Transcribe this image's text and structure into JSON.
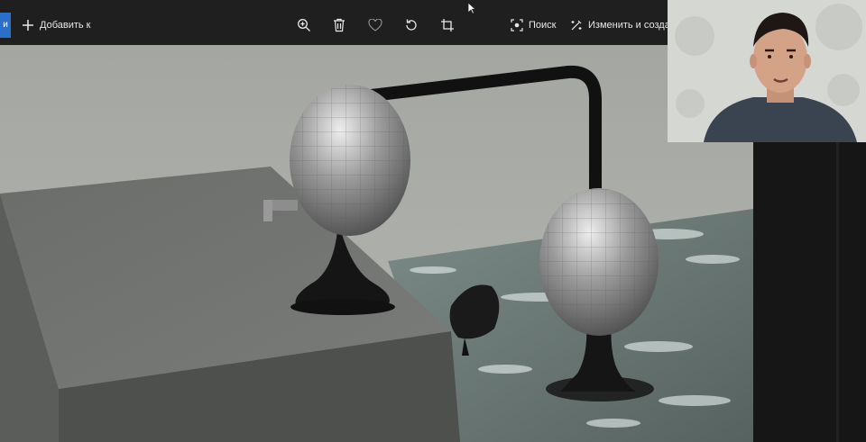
{
  "toolbar": {
    "edge_tab_label": "и",
    "add_label": "Добавить к",
    "search_label": "Поиск",
    "edit_create_label": "Изменить и создать",
    "icons": {
      "add": "plus-icon",
      "zoom": "zoom-in-icon",
      "delete": "trash-icon",
      "favorite": "heart-icon",
      "rotate": "rotate-icon",
      "crop": "crop-icon",
      "search": "visual-search-icon",
      "edit": "edit-create-icon"
    }
  },
  "colors": {
    "toolbar_bg": "#1f1f1f",
    "accent": "#2b6fc9",
    "text": "#e8e8e8",
    "scene_bg": "#a9aba7"
  }
}
